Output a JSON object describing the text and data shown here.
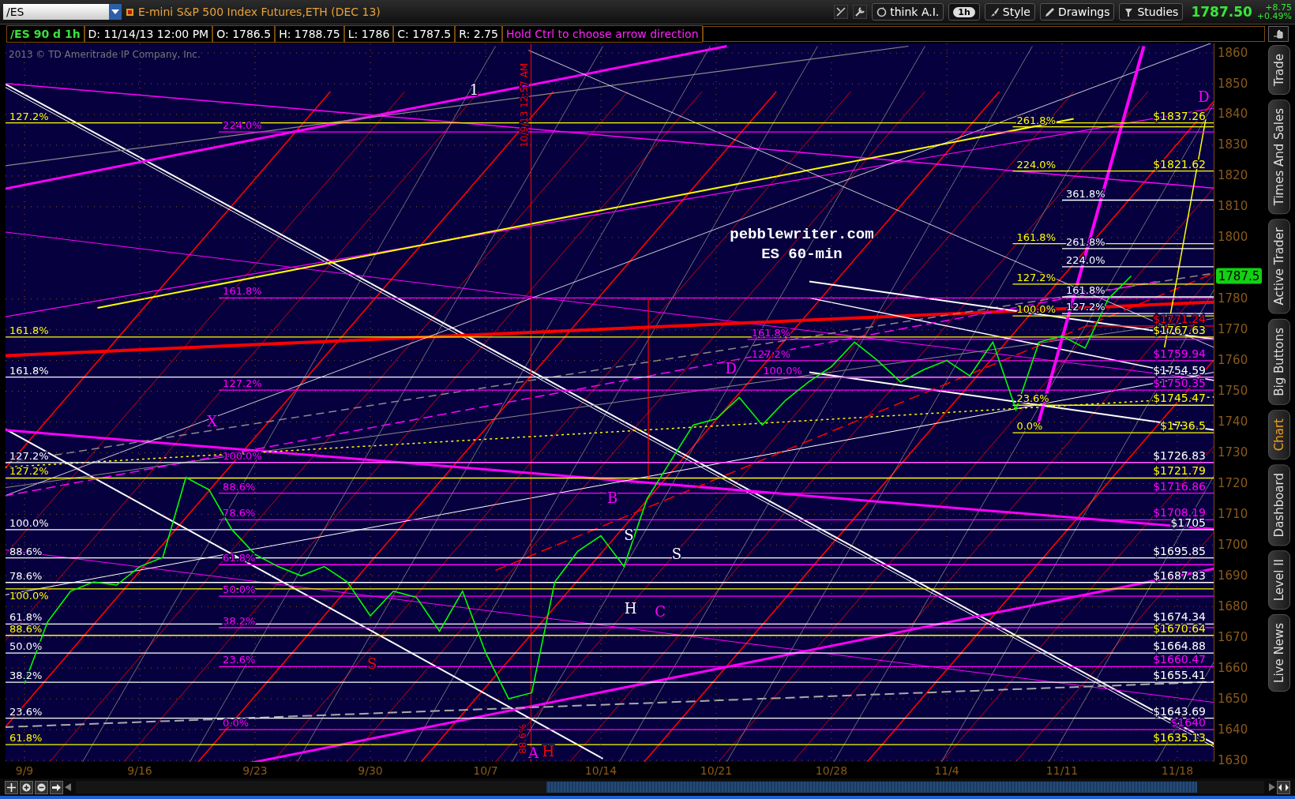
{
  "toolbar": {
    "symbol": "/ES",
    "description": "E-mini S&P 500 Index Futures,ETH (DEC 13)",
    "buttons": [
      {
        "kind": "ai",
        "label": "think A.I."
      },
      {
        "kind": "interval",
        "label": "1h"
      },
      {
        "kind": "style",
        "label": "Style"
      },
      {
        "kind": "drawings",
        "label": "Drawings"
      },
      {
        "kind": "studies",
        "label": "Studies"
      }
    ],
    "last": "1787.50",
    "change": "+8.75",
    "change_pct": "+0.49%"
  },
  "info_bar": {
    "study": "/ES 90 d 1h",
    "fields": [
      "D: 11/14/13 12:00 PM",
      "O: 1786.5",
      "H: 1788.75",
      "L: 1786",
      "C: 1787.5",
      "R: 2.75"
    ],
    "hint": "Hold Ctrl to choose arrow direction"
  },
  "chart": {
    "copyright": "2013 © TD Ameritrade IP Company, Inc.",
    "last_price_tag": "1787.5",
    "chart_data": {
      "type": "line",
      "categories": [
        "9/9",
        null,
        null,
        null,
        null,
        "9/16",
        null,
        null,
        null,
        null,
        "9/23",
        null,
        null,
        null,
        null,
        "9/30",
        null,
        null,
        null,
        null,
        "10/7",
        null,
        null,
        null,
        null,
        "10/14",
        null,
        null,
        null,
        null,
        "10/21",
        null,
        null,
        null,
        null,
        "10/28",
        null,
        null,
        null,
        null,
        "11/4",
        null,
        null,
        null,
        null,
        "11/11",
        null,
        null,
        null,
        null,
        "11/18"
      ],
      "series": [
        {
          "color": "#00ff00",
          "values": [
            1655,
            1675,
            1685,
            1688,
            1687,
            1693,
            1696,
            1722,
            1718,
            1705,
            1697,
            1693,
            1690,
            1693,
            1688,
            1677,
            1685,
            1683,
            1672,
            1685,
            1665,
            1650,
            1652,
            1688,
            1698,
            1703,
            1693,
            1715,
            1727,
            1739,
            1741,
            1748,
            1739,
            1747,
            1753,
            1758,
            1766,
            1760,
            1753,
            1757,
            1760,
            1755,
            1766,
            1744,
            1766,
            1768,
            1764,
            1780,
            1787.5,
            null,
            null
          ]
        }
      ],
      "ylim": [
        1629.5,
        1863.1
      ],
      "grid": true,
      "yticks": [
        1630,
        1640,
        1650,
        1660,
        1670,
        1680,
        1690,
        1700,
        1710,
        1720,
        1730,
        1740,
        1750,
        1760,
        1770,
        1780,
        1800,
        1810,
        1820,
        1830,
        1840,
        1850,
        1860
      ],
      "annotations": [
        "127.2%",
        "$1837.26",
        "161.8%",
        "$1767.63",
        "161.8%",
        "$1754.59",
        "127.2%",
        "$1726.83",
        "127.2%",
        "$1721.79",
        "100.0%",
        "$1705",
        "88.6%",
        "$1695.85",
        "78.6%",
        "$1687.83",
        "100.0%",
        "61.8%",
        "$1674.34",
        "88.6%",
        "$1670.64",
        "50.0%",
        "$1664.88",
        "38.2%",
        "$1655.41",
        "23.6%",
        "$1643.69",
        "61.8%",
        "$1635.13",
        "224.0%",
        "161.8%",
        "127.2%",
        "$1750.35",
        "100.0%",
        "88.6%",
        "$1716.86",
        "78.6%",
        "$1708.19",
        "61.8%",
        "50.0%",
        "38.2%",
        "23.6%",
        "$1660.47",
        "0.0%",
        "$1640",
        "161.8%",
        "127.2%",
        "$1759.94",
        "100.0%",
        "261.8%",
        "224.0%",
        "$1821.62",
        "161.8%",
        "127.2%",
        "100.0%",
        "23.6%",
        "$1745.47",
        "0.0%",
        "$1736.5",
        "361.8%",
        "261.8%",
        "224.0%",
        "161.8%",
        "127.2%",
        "$1771.24",
        "1",
        "X",
        "S",
        "B",
        "S",
        "S",
        "H",
        "C",
        "A",
        "H",
        "D",
        "D",
        "pebblewriter.com",
        "ES 60-min",
        "10/9/13 12:57 AM",
        "88.6%"
      ]
    }
  },
  "side_tabs": [
    {
      "label": "Trade",
      "selected": false
    },
    {
      "label": "Times And Sales",
      "selected": false
    },
    {
      "label": "Active Trader",
      "selected": false
    },
    {
      "label": "Big Buttons",
      "selected": false
    },
    {
      "label": "Chart",
      "selected": true
    },
    {
      "label": "Dashboard",
      "selected": false
    },
    {
      "label": "Level II",
      "selected": false
    },
    {
      "label": "Live News",
      "selected": false
    }
  ]
}
